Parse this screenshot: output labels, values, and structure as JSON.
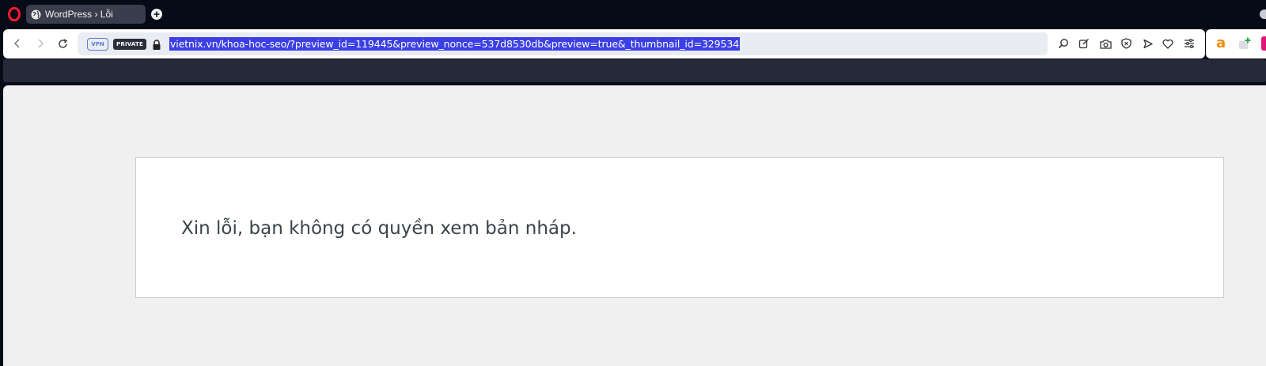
{
  "browser": {
    "tab": {
      "title": "WordPress › Lỗi"
    },
    "badges": {
      "vpn": "VPN",
      "private": "PRIVATE"
    },
    "url": "vietnix.vn/khoa-hoc-seo/?preview_id=119445&preview_nonce=537d8530db&preview=true&_thumbnail_id=329534",
    "toolbar_icons": [
      "search-page-icon",
      "edit-icon",
      "camera-icon",
      "shield-icon",
      "send-icon",
      "heart-icon",
      "easy-setup-icon"
    ],
    "extensions": {
      "a_label": "a"
    }
  },
  "page": {
    "error_message": "Xin lỗi, bạn không có quyền xem bản nháp."
  },
  "colors": {
    "chrome_dark": "#070b17",
    "tab_bg": "#3a3d4b",
    "url_selection": "#3c3fe6",
    "page_bg": "#f0f0f0",
    "text": "#3c434a"
  }
}
